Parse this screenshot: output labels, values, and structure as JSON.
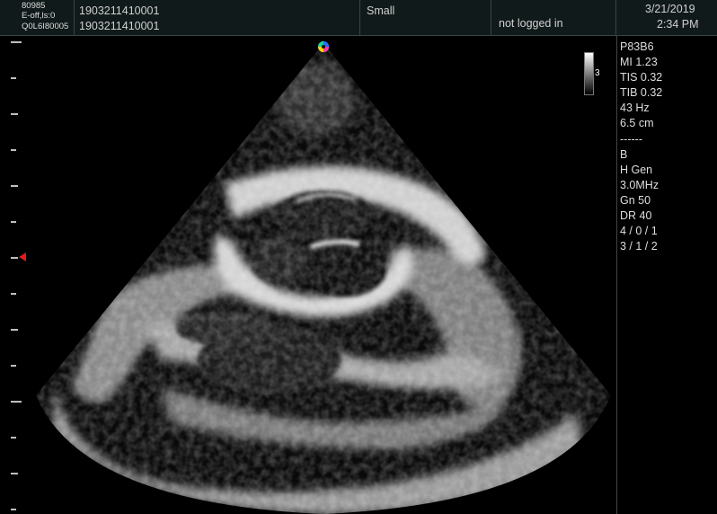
{
  "topbar": {
    "id_top": "80985",
    "id_mid": "E-off,ls:0",
    "id_bot": "Q0L6I80005",
    "patient_id_1": "1903211410001",
    "patient_id_2": "1903211410001",
    "size_label": "Small",
    "login_status": "not logged in",
    "date": "3/21/2019",
    "time": "2:34 PM"
  },
  "params": [
    "P83B6",
    "MI 1.23",
    "TIS 0.32",
    "TIB 0.32",
    "43 Hz",
    "6.5 cm",
    "------",
    "B",
    "H  Gen",
    "3.0MHz",
    "Gn 50",
    "DR 40",
    "4 / 0 / 1",
    "3 / 1 / 2"
  ],
  "graymap_label": "3",
  "colors": {
    "marker": "#e21a1a",
    "background": "#000000",
    "topbar": "#111a1a"
  }
}
